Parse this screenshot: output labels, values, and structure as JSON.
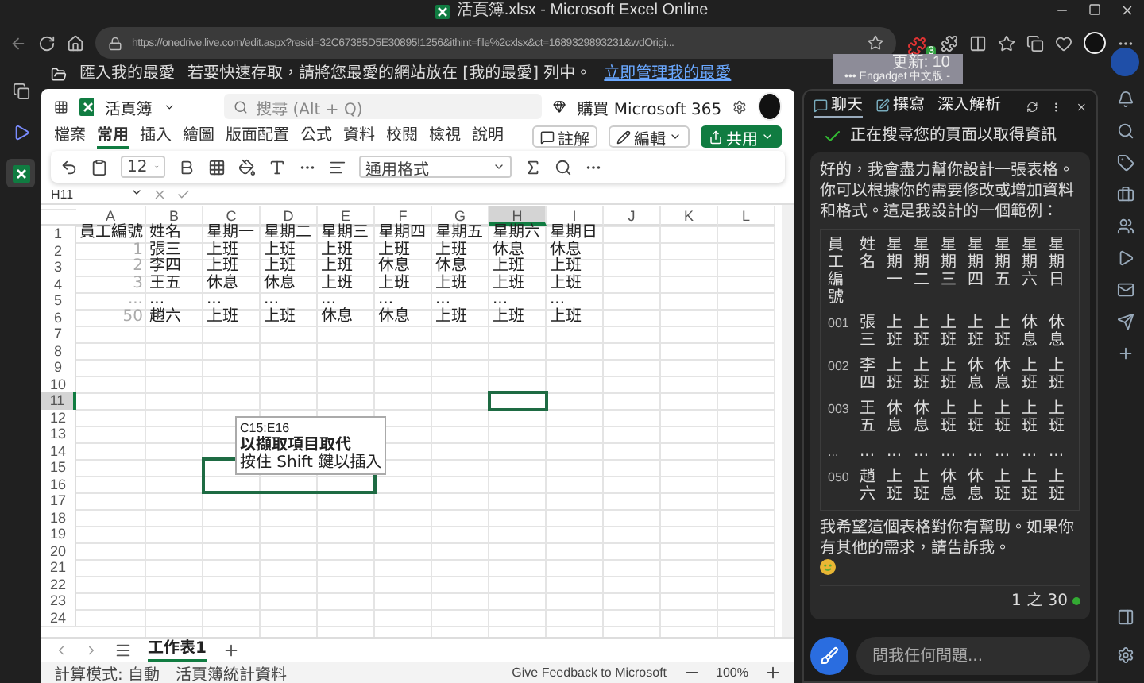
{
  "browser": {
    "title": "活頁簿.xlsx - Microsoft Excel Online",
    "url": "https://onedrive.live.com/edit.aspx?resid=32C67385D5E30895!1256&ithint=file%2cxlsx&ct=1689329893231&wdOrigi...",
    "extension_badge": "3"
  },
  "favorites_bar": {
    "import": "匯入我的最愛",
    "hint": "若要快速存取，請將您最愛的網站放在 [我的最愛] 列中。",
    "link": "立即管理我的最愛"
  },
  "notification": {
    "title": "更新: 10",
    "source": "••• Engadget 中文版 -"
  },
  "excel": {
    "file_name": "活頁簿",
    "search_placeholder": "搜尋 (Alt + Q)",
    "buy": "購買 Microsoft 365",
    "ribbon_tabs": [
      {
        "label": "檔案",
        "selected": false
      },
      {
        "label": "常用",
        "selected": true
      },
      {
        "label": "插入",
        "selected": false
      },
      {
        "label": "繪圖",
        "selected": false
      },
      {
        "label": "版面配置",
        "selected": false
      },
      {
        "label": "公式",
        "selected": false
      },
      {
        "label": "資料",
        "selected": false
      },
      {
        "label": "校閱",
        "selected": false
      },
      {
        "label": "檢視",
        "selected": false
      },
      {
        "label": "說明",
        "selected": false
      }
    ],
    "comment": "註解",
    "edit": "編輯",
    "share": "共用",
    "font_size": "12",
    "number_format": "通用格式",
    "name_box": "H11",
    "columns": [
      {
        "label": "A",
        "selected": false
      },
      {
        "label": "B",
        "selected": false
      },
      {
        "label": "C",
        "selected": false
      },
      {
        "label": "D",
        "selected": false
      },
      {
        "label": "E",
        "selected": false
      },
      {
        "label": "F",
        "selected": false
      },
      {
        "label": "G",
        "selected": false
      },
      {
        "label": "H",
        "selected": true
      },
      {
        "label": "I",
        "selected": false
      },
      {
        "label": "J",
        "selected": false
      },
      {
        "label": "K",
        "selected": false
      },
      {
        "label": "L",
        "selected": false
      }
    ],
    "rows": [
      {
        "header": "1",
        "selected": false,
        "cells": [
          "員工編號",
          "姓名",
          "星期一",
          "星期二",
          "星期三",
          "星期四",
          "星期五",
          "星期六",
          "星期日"
        ]
      },
      {
        "header": "2",
        "selected": false,
        "cells": [
          "1",
          "張三",
          "上班",
          "上班",
          "上班",
          "上班",
          "上班",
          "休息",
          "休息"
        ]
      },
      {
        "header": "3",
        "selected": false,
        "cells": [
          "2",
          "李四",
          "上班",
          "上班",
          "上班",
          "休息",
          "休息",
          "上班",
          "上班"
        ]
      },
      {
        "header": "4",
        "selected": false,
        "cells": [
          "3",
          "王五",
          "休息",
          "休息",
          "上班",
          "上班",
          "上班",
          "上班",
          "上班"
        ]
      },
      {
        "header": "5",
        "selected": false,
        "cells": [
          "...",
          "...",
          "...",
          "...",
          "...",
          "...",
          "...",
          "...",
          "..."
        ]
      },
      {
        "header": "6",
        "selected": false,
        "cells": [
          "50",
          "趙六",
          "上班",
          "上班",
          "休息",
          "休息",
          "上班",
          "上班",
          "上班"
        ]
      },
      {
        "header": "7",
        "selected": false,
        "cells": []
      },
      {
        "header": "8",
        "selected": false,
        "cells": []
      },
      {
        "header": "9",
        "selected": false,
        "cells": []
      },
      {
        "header": "10",
        "selected": false,
        "cells": []
      },
      {
        "header": "11",
        "selected": true,
        "cells": []
      },
      {
        "header": "12",
        "selected": false,
        "cells": []
      },
      {
        "header": "13",
        "selected": false,
        "cells": []
      },
      {
        "header": "14",
        "selected": false,
        "cells": []
      },
      {
        "header": "15",
        "selected": false,
        "cells": []
      },
      {
        "header": "16",
        "selected": false,
        "cells": []
      },
      {
        "header": "17",
        "selected": false,
        "cells": []
      },
      {
        "header": "18",
        "selected": false,
        "cells": []
      },
      {
        "header": "19",
        "selected": false,
        "cells": []
      },
      {
        "header": "20",
        "selected": false,
        "cells": []
      },
      {
        "header": "21",
        "selected": false,
        "cells": []
      },
      {
        "header": "22",
        "selected": false,
        "cells": []
      },
      {
        "header": "23",
        "selected": false,
        "cells": []
      },
      {
        "header": "24",
        "selected": false,
        "cells": []
      }
    ],
    "drag_tooltip": [
      "C15:E16",
      "以擷取項目取代",
      "按住 Shift 鍵以插入"
    ],
    "sheet_tabs": [
      {
        "label": "工作表1",
        "selected": true
      }
    ],
    "status_bar": {
      "calc": "計算模式: 自動",
      "stats": "活頁簿統計資料",
      "feedback": "Give Feedback to Microsoft",
      "zoom": "100%"
    }
  },
  "copilot": {
    "tabs": [
      {
        "label": "聊天",
        "selected": true
      },
      {
        "label": "撰寫",
        "selected": false
      },
      {
        "label": "深入解析",
        "selected": false
      }
    ],
    "status": "正在搜尋您的頁面以取得資訊",
    "intro": "好的，我會盡力幫你設計一張表格。你可以根據你的需要修改或增加資料和格式。這是我設計的一個範例：",
    "table": {
      "header": [
        "員工編號",
        "姓名",
        "星期一",
        "星期二",
        "星期三",
        "星期四",
        "星期五",
        "星期六",
        "星期日"
      ],
      "rows": [
        [
          "001",
          "張三",
          "上班",
          "上班",
          "上班",
          "上班",
          "上班",
          "休息",
          "休息"
        ],
        [
          "002",
          "李四",
          "上班",
          "上班",
          "上班",
          "休息",
          "休息",
          "上班",
          "上班"
        ],
        [
          "003",
          "王五",
          "休息",
          "休息",
          "上班",
          "上班",
          "上班",
          "上班",
          "上班"
        ],
        [
          "...",
          "...",
          "...",
          "...",
          "...",
          "...",
          "...",
          "...",
          "..."
        ],
        [
          "050",
          "趙六",
          "上班",
          "上班",
          "休息",
          "休息",
          "上班",
          "上班",
          "上班"
        ]
      ]
    },
    "outro": "我希望這個表格對你有幫助。如果你有其他的需求，請告訴我。",
    "counter": "1 之 30",
    "input_placeholder": "問我任何問題..."
  }
}
